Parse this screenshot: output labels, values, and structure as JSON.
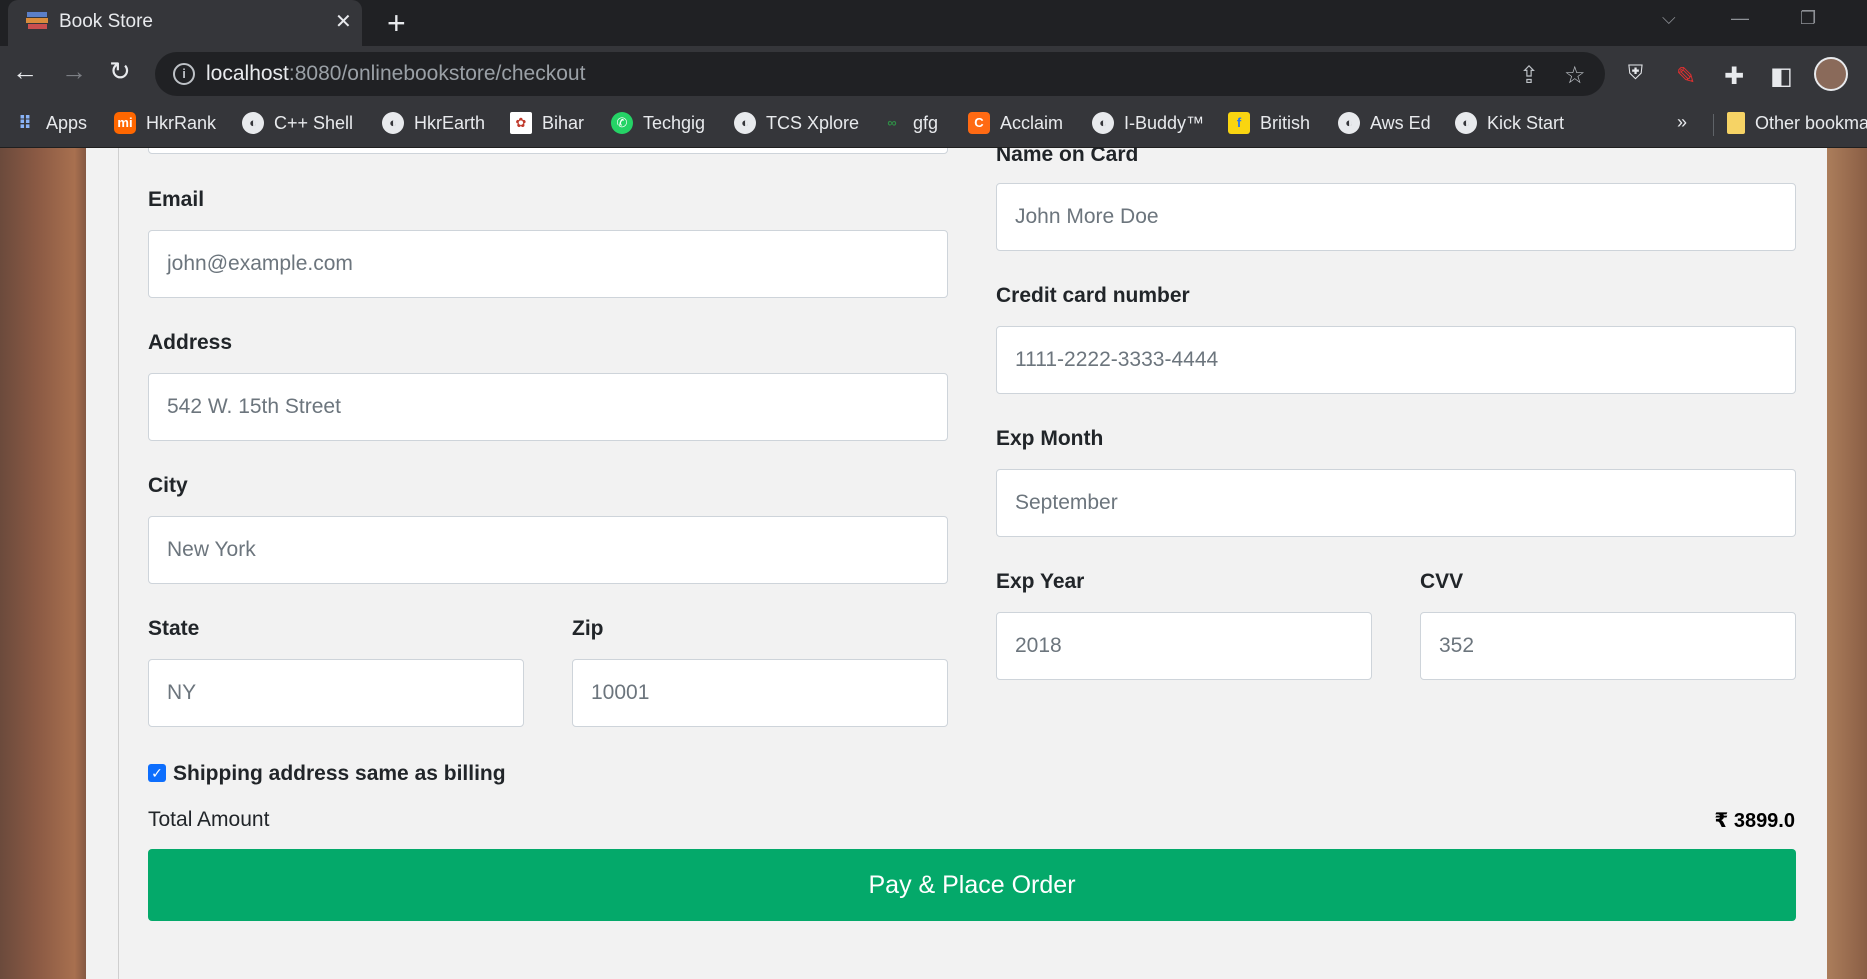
{
  "browser": {
    "tab_title": "Book Store",
    "tab_close": "✕",
    "new_tab": "+",
    "url_host": "localhost",
    "url_path": ":8080/onlinebookstore/checkout",
    "bookmarks": [
      {
        "label": "Apps",
        "icon": "apps-grid-icon",
        "color": "#8ab4f8"
      },
      {
        "label": "HkrRank",
        "icon": "mi-icon",
        "color": "#ff6700"
      },
      {
        "label": "C++ Shell",
        "icon": "globe-icon",
        "color": "#e8eaed"
      },
      {
        "label": "HkrEarth",
        "icon": "globe-icon",
        "color": "#e8eaed"
      },
      {
        "label": "Bihar",
        "icon": "emblem-icon",
        "color": "#c0392b"
      },
      {
        "label": "Techgig",
        "icon": "whatsapp-icon",
        "color": "#25d366"
      },
      {
        "label": "TCS Xplore",
        "icon": "globe-icon",
        "color": "#e8eaed"
      },
      {
        "label": "gfg",
        "icon": "gfg-icon",
        "color": "#2f8d46"
      },
      {
        "label": "Acclaim",
        "icon": "acclaim-icon",
        "color": "#ff6a13"
      },
      {
        "label": "I-Buddy™",
        "icon": "globe-icon",
        "color": "#e8eaed"
      },
      {
        "label": "British",
        "icon": "flipkart-icon",
        "color": "#f9d511"
      },
      {
        "label": "Aws Ed",
        "icon": "globe-icon",
        "color": "#e8eaed"
      },
      {
        "label": "Kick Start",
        "icon": "globe-icon",
        "color": "#e8eaed"
      }
    ],
    "overflow": "»",
    "other_bookmarks": "Other bookma"
  },
  "form": {
    "email": {
      "label": "Email",
      "placeholder": "john@example.com"
    },
    "address": {
      "label": "Address",
      "placeholder": "542 W. 15th Street"
    },
    "city": {
      "label": "City",
      "placeholder": "New York"
    },
    "state": {
      "label": "State",
      "placeholder": "NY"
    },
    "zip": {
      "label": "Zip",
      "placeholder": "10001"
    },
    "name_on_card": {
      "label": "Name on Card",
      "placeholder": "John More Doe"
    },
    "card_number": {
      "label": "Credit card number",
      "placeholder": "1111-2222-3333-4444"
    },
    "exp_month": {
      "label": "Exp Month",
      "placeholder": "September"
    },
    "exp_year": {
      "label": "Exp Year",
      "placeholder": "2018"
    },
    "cvv": {
      "label": "CVV",
      "placeholder": "352"
    },
    "same_address": {
      "label": "Shipping address same as billing",
      "checked": true
    },
    "total_label": "Total Amount",
    "total_value": "₹ 3899.0",
    "submit_label": "Pay & Place Order",
    "accent_color": "#04a96a"
  }
}
